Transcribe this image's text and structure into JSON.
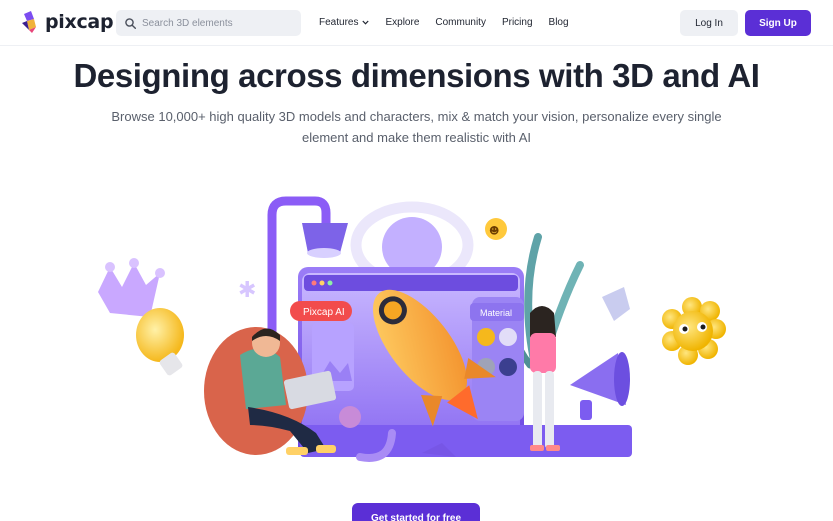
{
  "nav": {
    "logo_text": "pixcap",
    "search_placeholder": "Search 3D elements",
    "menu": [
      {
        "label": "Features",
        "has_dropdown": true
      },
      {
        "label": "Explore"
      },
      {
        "label": "Community"
      },
      {
        "label": "Pricing"
      },
      {
        "label": "Blog"
      }
    ],
    "login_label": "Log In",
    "signup_label": "Sign Up"
  },
  "hero": {
    "headline": "Designing across dimensions with 3D and AI",
    "subhead": "Browse 10,000+ high quality 3D models and characters, mix & match your vision, personalize every single element and make them realistic with AI",
    "illustration": {
      "ai_tag": "Pixcap AI",
      "material_tag": "Material"
    },
    "cta_label": "Get started for free"
  },
  "colors": {
    "brand": "#5b2fd6",
    "text": "#1d2230",
    "muted": "#5a606c",
    "chip_bg": "#eef0f4"
  },
  "icons": [
    "pixcap-logo-icon",
    "search-icon",
    "chevron-down-icon"
  ]
}
